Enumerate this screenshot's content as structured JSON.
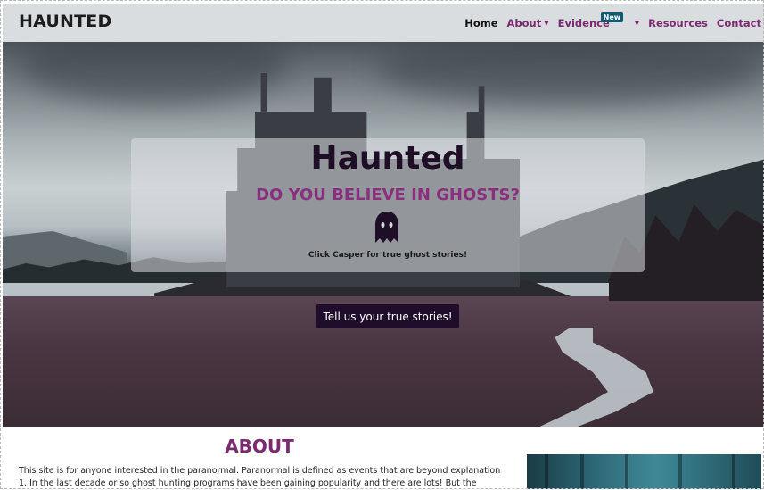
{
  "navbar": {
    "brand": "HAUNTED",
    "links": [
      {
        "label": "Home",
        "active": true
      },
      {
        "label": "About",
        "dropdown": true
      },
      {
        "label": "Evidence",
        "dropdown": true,
        "badge": "New"
      },
      {
        "label": "Resources"
      },
      {
        "label": "Contact"
      }
    ]
  },
  "hero": {
    "title": "Haunted",
    "subtitle": "DO YOU BELIEVE IN GHOSTS?",
    "ghost_icon": "ghost-icon",
    "caption": "Click Casper for true ghost stories!",
    "cta_label": "Tell us your true stories!"
  },
  "about": {
    "heading": "ABOUT",
    "lines": [
      "This site is for anyone interested in the paranormal. Paranormal is defined as events that are beyond explanation",
      "1. In the last decade or so ghost hunting programs have been gaining popularity and there are lots! But the"
    ]
  },
  "colors": {
    "navbar_bg": "#d9dde0",
    "accent_purple": "#7b2a6f",
    "badge_teal": "#0f5b73",
    "cta_bg": "#1f0d2b"
  }
}
